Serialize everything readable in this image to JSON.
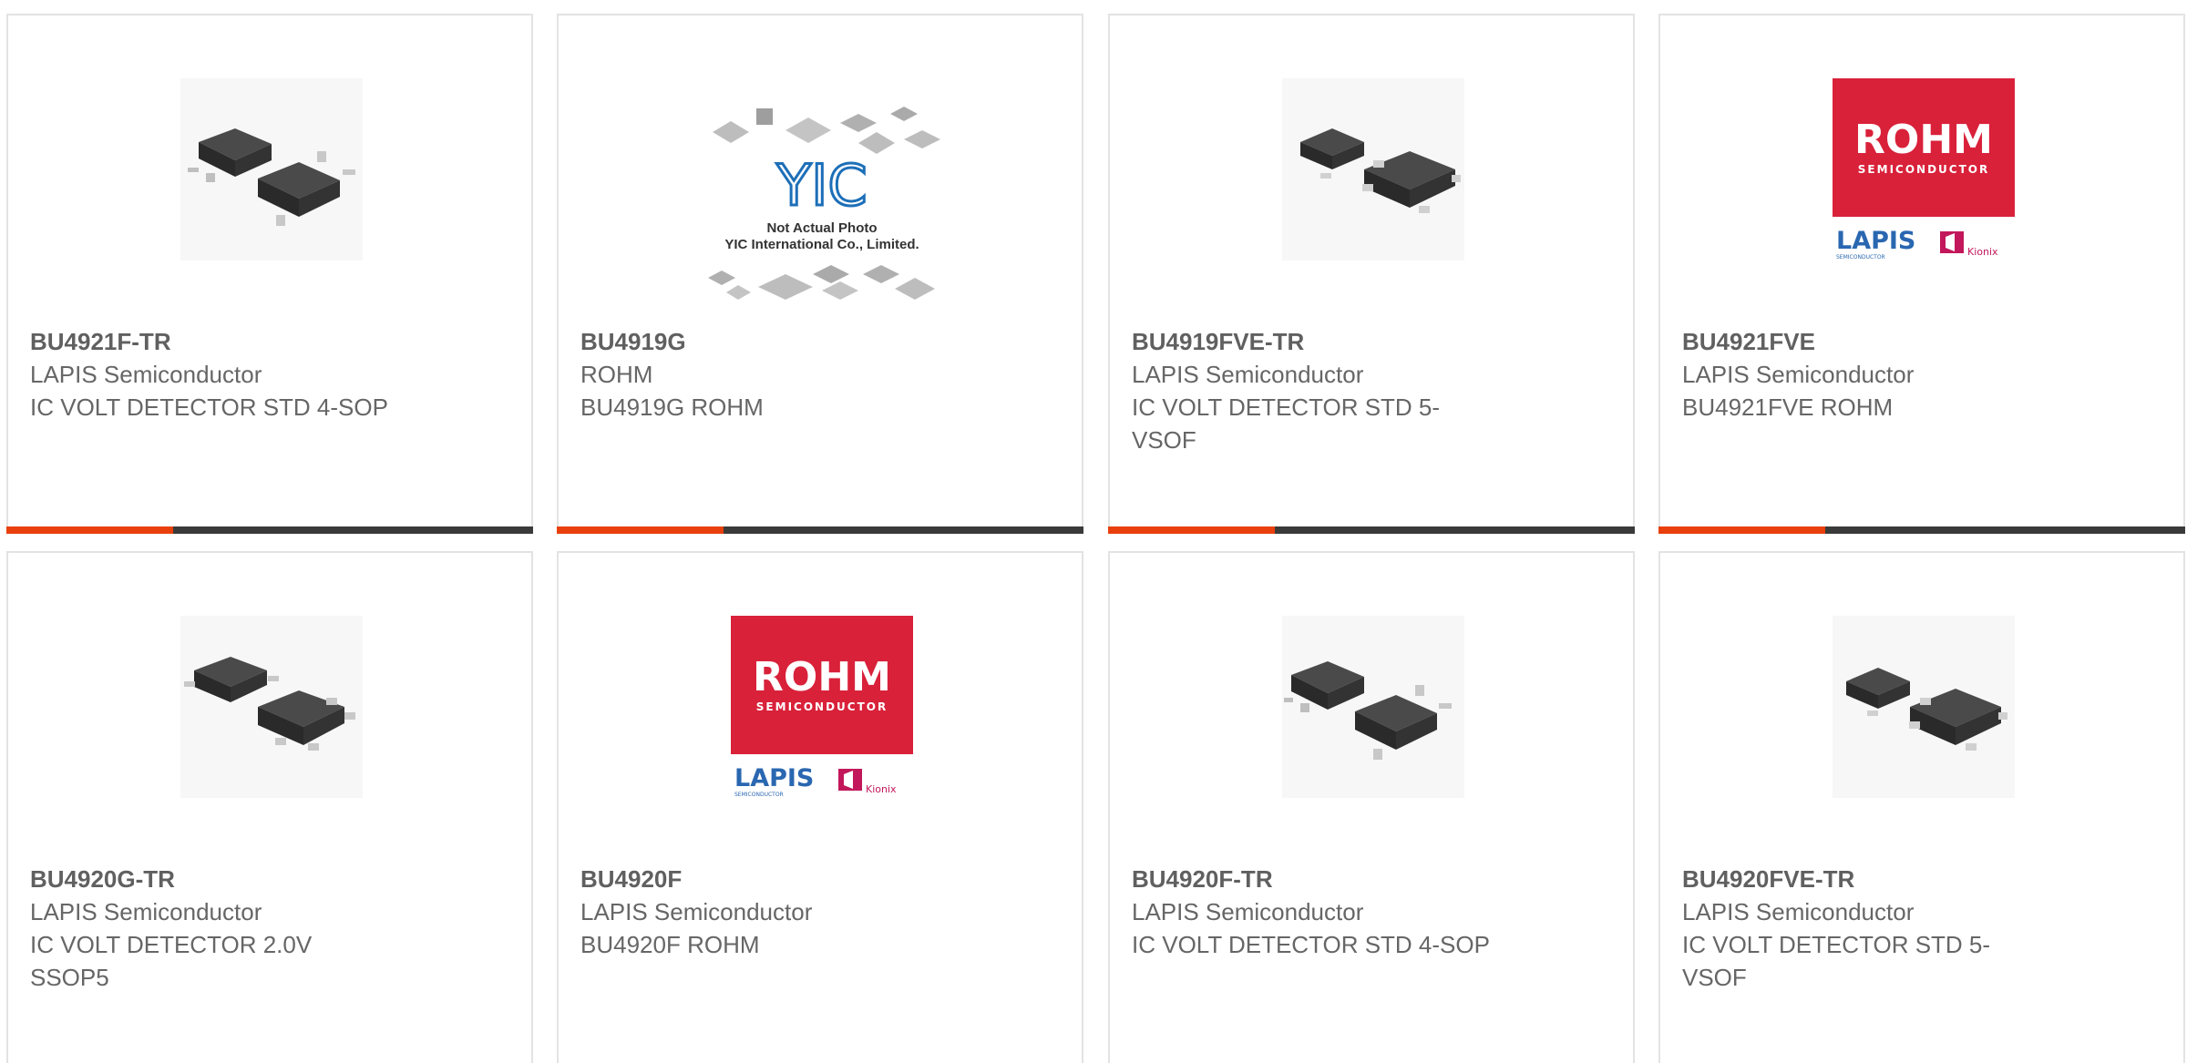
{
  "colors": {
    "accent_orange": "#e8400c",
    "accent_dark": "#3a3a3a",
    "card_border": "#e3e3e3",
    "text": "#666666",
    "rohm_red": "#d9213a",
    "lapis_blue": "#2a67b1",
    "kionix_magenta": "#c2185b"
  },
  "products": [
    {
      "part": "BU4921F-TR",
      "manufacturer": "LAPIS Semiconductor",
      "description": "IC VOLT DETECTOR STD 4-SOP",
      "image": "chip-sop4-image"
    },
    {
      "part": "BU4919G",
      "manufacturer": "ROHM",
      "description": "BU4919G ROHM",
      "image": "yic-placeholder-image",
      "image_text": {
        "brand": "YIC",
        "line1": "Not Actual Photo",
        "line2": "YIC International Co., Limited."
      }
    },
    {
      "part": "BU4919FVE-TR",
      "manufacturer": "LAPIS Semiconductor",
      "description": "IC VOLT DETECTOR STD 5-VSOF",
      "image": "chip-vsof5-image"
    },
    {
      "part": "BU4921FVE",
      "manufacturer": "LAPIS Semiconductor",
      "description": "BU4921FVE ROHM",
      "image": "rohm-logo-image",
      "logo_text": {
        "rohm": "ROHM",
        "semi": "SEMICONDUCTOR",
        "lapis": "LAPIS",
        "lapis_sub": "SEMICONDUCTOR",
        "kionix": "Kionix"
      }
    },
    {
      "part": "BU4920G-TR",
      "manufacturer": "LAPIS Semiconductor",
      "description": "IC VOLT DETECTOR 2.0V SSOP5",
      "image": "chip-ssop5-image"
    },
    {
      "part": "BU4920F",
      "manufacturer": "LAPIS Semiconductor",
      "description": "BU4920F ROHM",
      "image": "rohm-logo-image",
      "logo_text": {
        "rohm": "ROHM",
        "semi": "SEMICONDUCTOR",
        "lapis": "LAPIS",
        "lapis_sub": "SEMICONDUCTOR",
        "kionix": "Kionix"
      }
    },
    {
      "part": "BU4920F-TR",
      "manufacturer": "LAPIS Semiconductor",
      "description": "IC VOLT DETECTOR STD 4-SOP",
      "image": "chip-sop4-image"
    },
    {
      "part": "BU4920FVE-TR",
      "manufacturer": "LAPIS Semiconductor",
      "description": "IC VOLT DETECTOR STD 5-VSOF",
      "image": "chip-vsof5-image"
    }
  ]
}
